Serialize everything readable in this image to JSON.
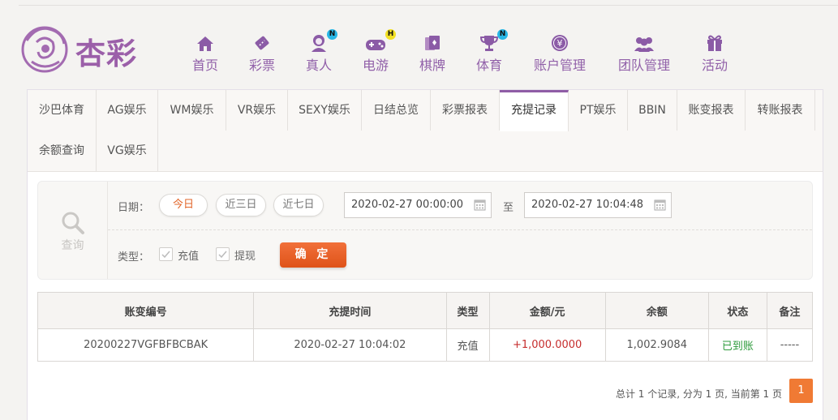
{
  "brand": {
    "logo_text": "杏彩"
  },
  "nav": [
    {
      "label": "首页",
      "icon": "home-icon",
      "badge": ""
    },
    {
      "label": "彩票",
      "icon": "ticket-icon",
      "badge": ""
    },
    {
      "label": "真人",
      "icon": "dealer-icon",
      "badge": "N"
    },
    {
      "label": "电游",
      "icon": "gamepad-icon",
      "badge": "H"
    },
    {
      "label": "棋牌",
      "icon": "cards-icon",
      "badge": ""
    },
    {
      "label": "体育",
      "icon": "trophy-icon",
      "badge": "N"
    },
    {
      "label": "账户管理",
      "icon": "yen-coin-icon",
      "badge": ""
    },
    {
      "label": "团队管理",
      "icon": "team-icon",
      "badge": ""
    },
    {
      "label": "活动",
      "icon": "gift-icon",
      "badge": ""
    }
  ],
  "tabs": [
    "沙巴体育",
    "AG娱乐",
    "WM娱乐",
    "VR娱乐",
    "SEXY娱乐",
    "日结总览",
    "彩票报表",
    "充提记录",
    "PT娱乐",
    "BBIN",
    "账变报表",
    "转账报表",
    "余额查询",
    "VG娱乐"
  ],
  "active_tab": "充提记录",
  "query": {
    "side_label": "查询",
    "date_label": "日期：",
    "ranges": [
      "今日",
      "近三日",
      "近七日"
    ],
    "active_range": "今日",
    "start": "2020-02-27 00:00:00",
    "sep": "至",
    "end": "2020-02-27 10:04:48",
    "type_label": "类型：",
    "types": [
      "充值",
      "提现"
    ],
    "submit": "确 定"
  },
  "table": {
    "headers": [
      "账变编号",
      "充提时间",
      "类型",
      "金额/元",
      "余额",
      "状态",
      "备注"
    ],
    "rows": [
      [
        "20200227VGFBFBCBAK",
        "2020-02-27 10:04:02",
        "充值",
        "+1,000.0000",
        "1,002.9084",
        "已到账",
        "-----"
      ]
    ]
  },
  "pager": {
    "summary": "总计 1 个记录, 分为 1 页, 当前第 1 页",
    "current": "1"
  },
  "colors": {
    "brand": "#9160a9",
    "accent": "#e2662a",
    "positive": "#2e9b3c",
    "amount": "#c62d2d"
  }
}
